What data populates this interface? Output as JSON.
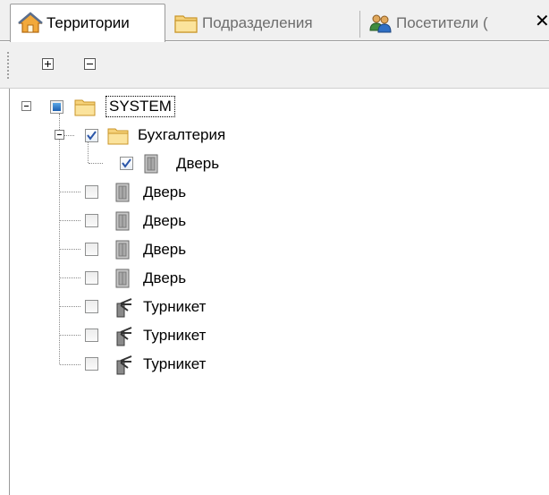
{
  "tabs": [
    {
      "label": "Территории",
      "icon": "territory-house-icon",
      "active": true
    },
    {
      "label": "Подразделения",
      "icon": "folder-icon",
      "active": false
    },
    {
      "label": "Посетители (",
      "icon": "visitors-people-icon",
      "active": false
    }
  ],
  "toolbar": {
    "expand_all": "expand-all-icon",
    "collapse_all": "collapse-all-icon"
  },
  "tree": {
    "root": {
      "label": "SYSTEM",
      "state": "partial",
      "icon": "folder-icon"
    },
    "group": {
      "label": "Бухгалтерия",
      "state": "checked",
      "icon": "folder-icon"
    },
    "group_children": [
      {
        "label": "Дверь",
        "state": "checked",
        "icon": "door-icon"
      }
    ],
    "root_children": [
      {
        "label": "Дверь",
        "state": "unchecked",
        "icon": "door-icon"
      },
      {
        "label": "Дверь",
        "state": "unchecked",
        "icon": "door-icon"
      },
      {
        "label": "Дверь",
        "state": "unchecked",
        "icon": "door-icon"
      },
      {
        "label": "Дверь",
        "state": "unchecked",
        "icon": "door-icon"
      },
      {
        "label": "Турникет",
        "state": "unchecked",
        "icon": "turnstile-icon"
      },
      {
        "label": "Турникет",
        "state": "unchecked",
        "icon": "turnstile-icon"
      },
      {
        "label": "Турникет",
        "state": "unchecked",
        "icon": "turnstile-icon"
      }
    ]
  },
  "colors": {
    "folder": "#f5c84c",
    "selection_blue": "#1c5fb0",
    "check": "#2a55a8"
  }
}
